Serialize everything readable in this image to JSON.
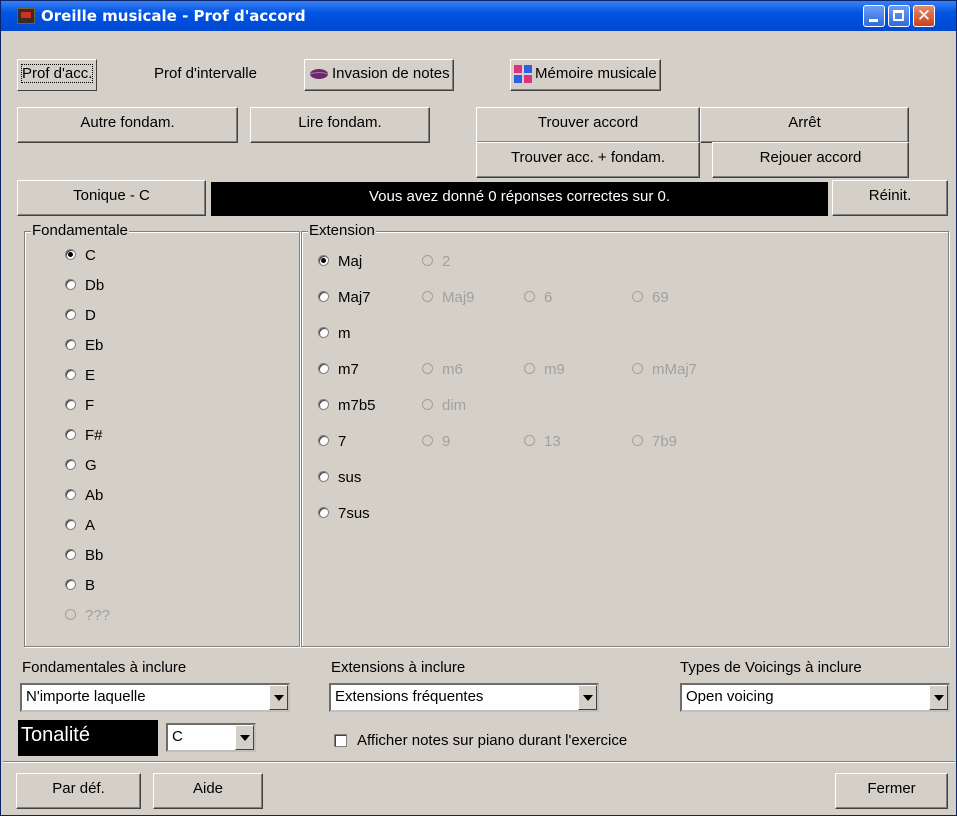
{
  "window": {
    "title": "Oreille musicale - Prof d'accord",
    "controls": {
      "minimize": "minimize-icon",
      "maximize": "maximize-icon",
      "close": "close-icon"
    }
  },
  "tabs": [
    {
      "label": "Prof d'acc.",
      "active": true
    },
    {
      "label": "Prof d'intervalle",
      "active": false
    },
    {
      "label": "Invasion de notes",
      "icon": "leaf-icon"
    },
    {
      "label": "Mémoire musicale",
      "icon": "grid-icon"
    }
  ],
  "buttons": {
    "autre_fondam": "Autre fondam.",
    "lire_fondam": "Lire fondam.",
    "trouver_accord": "Trouver accord",
    "arret": "Arrêt",
    "trouver_acc_fondam": "Trouver acc. + fondam.",
    "rejouer_accord": "Rejouer accord",
    "tonique": "Tonique - C",
    "reinit": "Réinit.",
    "par_def": "Par déf.",
    "aide": "Aide",
    "fermer": "Fermer"
  },
  "status_message": "Vous avez donné 0 réponses correctes sur 0.",
  "fondamentale": {
    "title": "Fondamentale",
    "options": [
      {
        "label": "C",
        "checked": true,
        "enabled": true
      },
      {
        "label": "Db",
        "checked": false,
        "enabled": true
      },
      {
        "label": "D",
        "checked": false,
        "enabled": true
      },
      {
        "label": "Eb",
        "checked": false,
        "enabled": true
      },
      {
        "label": "E",
        "checked": false,
        "enabled": true
      },
      {
        "label": "F",
        "checked": false,
        "enabled": true
      },
      {
        "label": "F#",
        "checked": false,
        "enabled": true
      },
      {
        "label": "G",
        "checked": false,
        "enabled": true
      },
      {
        "label": "Ab",
        "checked": false,
        "enabled": true
      },
      {
        "label": "A",
        "checked": false,
        "enabled": true
      },
      {
        "label": "Bb",
        "checked": false,
        "enabled": true
      },
      {
        "label": "B",
        "checked": false,
        "enabled": true
      },
      {
        "label": "???",
        "checked": false,
        "enabled": false
      }
    ]
  },
  "extension": {
    "title": "Extension",
    "rows": [
      [
        {
          "label": "Maj",
          "checked": true,
          "enabled": true
        },
        {
          "label": "2",
          "checked": false,
          "enabled": false
        }
      ],
      [
        {
          "label": "Maj7",
          "checked": false,
          "enabled": true
        },
        {
          "label": "Maj9",
          "checked": false,
          "enabled": false
        },
        {
          "label": "6",
          "checked": false,
          "enabled": false
        },
        {
          "label": "69",
          "checked": false,
          "enabled": false
        }
      ],
      [
        {
          "label": "m",
          "checked": false,
          "enabled": true
        }
      ],
      [
        {
          "label": "m7",
          "checked": false,
          "enabled": true
        },
        {
          "label": "m6",
          "checked": false,
          "enabled": false
        },
        {
          "label": "m9",
          "checked": false,
          "enabled": false
        },
        {
          "label": "mMaj7",
          "checked": false,
          "enabled": false
        }
      ],
      [
        {
          "label": "m7b5",
          "checked": false,
          "enabled": true
        },
        {
          "label": "dim",
          "checked": false,
          "enabled": false
        }
      ],
      [
        {
          "label": "7",
          "checked": false,
          "enabled": true
        },
        {
          "label": "9",
          "checked": false,
          "enabled": false
        },
        {
          "label": "13",
          "checked": false,
          "enabled": false
        },
        {
          "label": "7b9",
          "checked": false,
          "enabled": false
        }
      ],
      [
        {
          "label": "sus",
          "checked": false,
          "enabled": true
        }
      ],
      [
        {
          "label": "7sus",
          "checked": false,
          "enabled": true
        }
      ]
    ]
  },
  "filters": {
    "fondamentales_label": "Fondamentales à inclure",
    "fondamentales_value": "N'importe laquelle",
    "extensions_label": "Extensions à inclure",
    "extensions_value": "Extensions fréquentes",
    "voicings_label": "Types de Voicings à inclure",
    "voicings_value": "Open voicing"
  },
  "tonalite": {
    "label": "Tonalité",
    "value": "C"
  },
  "show_piano": {
    "label": "Afficher notes sur piano durant l'exercice",
    "checked": false
  }
}
